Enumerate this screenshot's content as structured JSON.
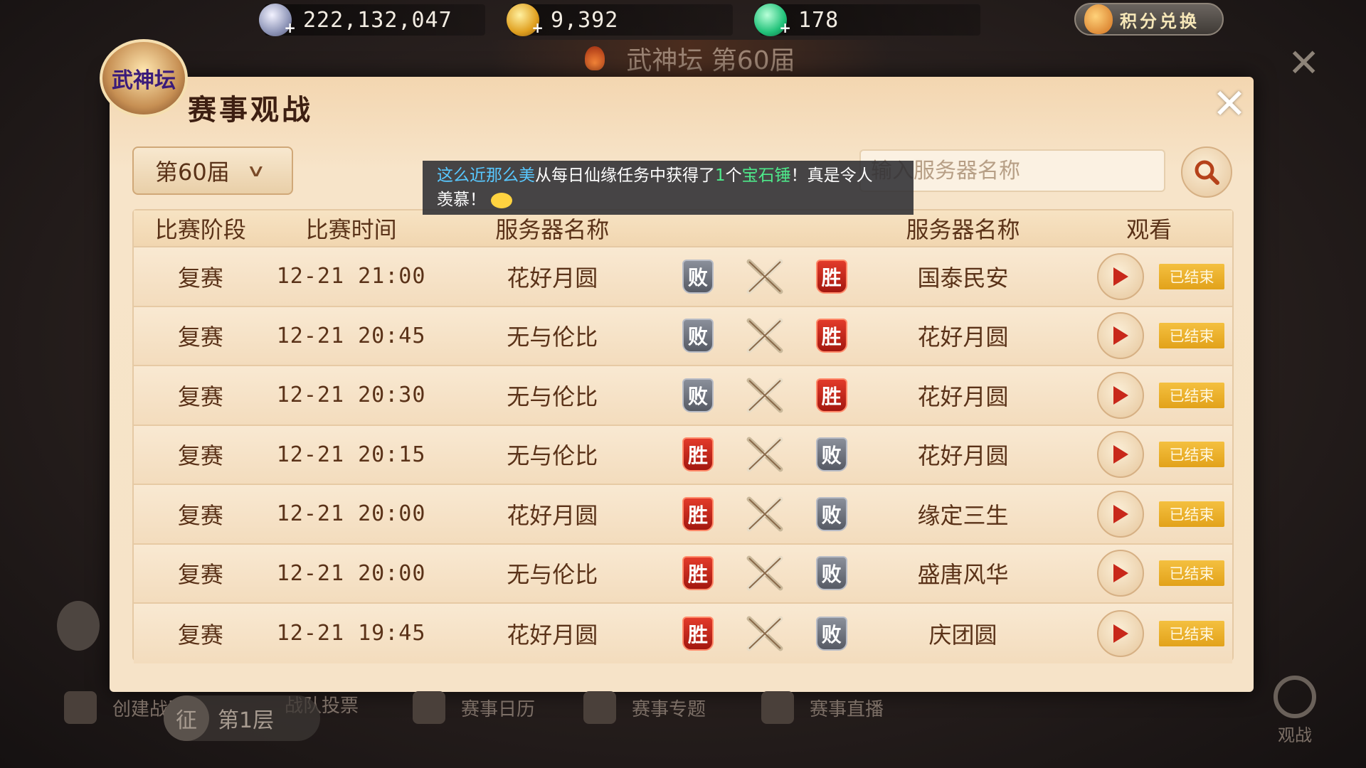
{
  "currency": {
    "silver": "222,132,047",
    "gold": "9,392",
    "jade": "178",
    "exchange_label": "积分兑换"
  },
  "background": {
    "title": "武神坛 第60届"
  },
  "panel": {
    "badge_text": "武神坛",
    "title": "赛事观战",
    "season_selected": "第60届",
    "search_placeholder": "输入服务器名称"
  },
  "notice": {
    "player": "这么近那么美",
    "text1": "从每日仙缘任务中获得了",
    "count": "1",
    "text2": "个",
    "item": "宝石锤",
    "text3": "！真是令人",
    "text4": "羡慕！"
  },
  "table": {
    "headers": {
      "stage": "比赛阶段",
      "time": "比赛时间",
      "server1": "服务器名称",
      "server2": "服务器名称",
      "watch": "观看"
    },
    "rows": [
      {
        "stage": "复赛",
        "time": "12-21  21:00",
        "server1": "花好月圆",
        "result1": "败",
        "result2": "胜",
        "server2": "国泰民安",
        "status": "已结束"
      },
      {
        "stage": "复赛",
        "time": "12-21  20:45",
        "server1": "无与伦比",
        "result1": "败",
        "result2": "胜",
        "server2": "花好月圆",
        "status": "已结束"
      },
      {
        "stage": "复赛",
        "time": "12-21  20:30",
        "server1": "无与伦比",
        "result1": "败",
        "result2": "胜",
        "server2": "花好月圆",
        "status": "已结束"
      },
      {
        "stage": "复赛",
        "time": "12-21  20:15",
        "server1": "无与伦比",
        "result1": "胜",
        "result2": "败",
        "server2": "花好月圆",
        "status": "已结束"
      },
      {
        "stage": "复赛",
        "time": "12-21  20:00",
        "server1": "花好月圆",
        "result1": "胜",
        "result2": "败",
        "server2": "缘定三生",
        "status": "已结束"
      },
      {
        "stage": "复赛",
        "time": "12-21  20:00",
        "server1": "无与伦比",
        "result1": "胜",
        "result2": "败",
        "server2": "盛唐风华",
        "status": "已结束"
      },
      {
        "stage": "复赛",
        "time": "12-21  19:45",
        "server1": "花好月圆",
        "result1": "胜",
        "result2": "败",
        "server2": "庆团圆",
        "status": "已结束"
      }
    ]
  },
  "bottom": {
    "create_team": "创建战队",
    "team_vote": "战队投票",
    "calendar": "赛事日历",
    "topic": "赛事专题",
    "live": "赛事直播",
    "floor_badge": "征",
    "floor": "第1层",
    "watch": "观战"
  },
  "colors": {
    "win": "#c8261a",
    "lose": "#6e727c",
    "ended_badge": "#eab030",
    "panel_bg": "#f6e3c8"
  }
}
